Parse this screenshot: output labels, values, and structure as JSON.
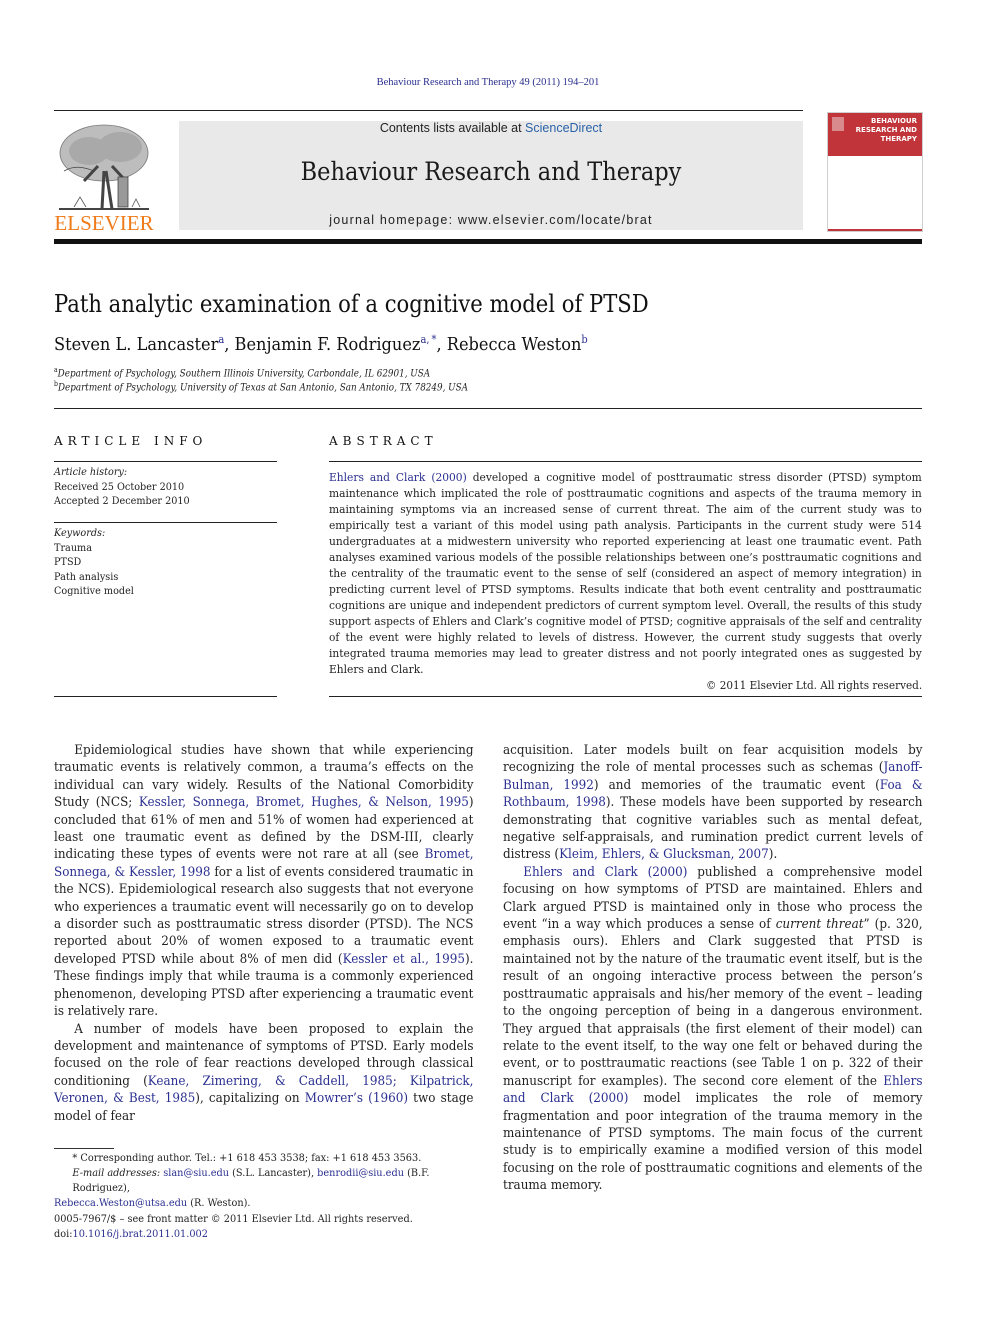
{
  "header": {
    "citation": "Behaviour Research and Therapy 49 (2011) 194–201",
    "publisher_logo_text": "ELSEVIER",
    "contents_prefix": "Contents lists available at ",
    "contents_link": "ScienceDirect",
    "journal_title": "Behaviour Research and Therapy",
    "homepage": "journal homepage: www.elsevier.com/locate/brat",
    "cover_title_lines": [
      "BEHAVIOUR",
      "RESEARCH AND",
      "THERAPY"
    ],
    "colors": {
      "brand_orange": "#f07b1a",
      "cover_red": "#c0343a",
      "link_blue": "#2a2f8f",
      "masthead_gray": "#e9e9e9"
    }
  },
  "article": {
    "title": "Path analytic examination of a cognitive model of PTSD",
    "authors": [
      {
        "name": "Steven L. Lancaster",
        "sup": "a"
      },
      {
        "name": "Benjamin F. Rodriguez",
        "sup": "a, *"
      },
      {
        "name": "Rebecca Weston",
        "sup": "b"
      }
    ],
    "affiliations": [
      {
        "sup": "a",
        "text": "Department of Psychology, Southern Illinois University, Carbondale, IL 62901, USA"
      },
      {
        "sup": "b",
        "text": "Department of Psychology, University of Texas at San Antonio, San Antonio, TX 78249, USA"
      }
    ]
  },
  "article_info": {
    "heading": "ARTICLE INFO",
    "history_label": "Article history:",
    "received": "Received 25 October 2010",
    "accepted": "Accepted 2 December 2010",
    "keywords_label": "Keywords:",
    "keywords": [
      "Trauma",
      "PTSD",
      "Path analysis",
      "Cognitive model"
    ]
  },
  "abstract": {
    "heading": "ABSTRACT",
    "link": "Ehlers and Clark (2000)",
    "text": " developed a cognitive model of posttraumatic stress disorder (PTSD) symptom maintenance which implicated the role of posttraumatic cognitions and aspects of the trauma memory in maintaining symptoms via an increased sense of current threat. The aim of the current study was to empirically test a variant of this model using path analysis. Participants in the current study were 514 undergraduates at a midwestern university who reported experiencing at least one traumatic event. Path analyses examined various models of the possible relationships between one’s posttraumatic cognitions and the centrality of the traumatic event to the sense of self (considered an aspect of memory integration) in predicting current level of PTSD symptoms. Results indicate that both event centrality and posttraumatic cognitions are unique and independent predictors of current symptom level. Overall, the results of this study support aspects of Ehlers and Clark’s cognitive model of PTSD; cognitive appraisals of the self and centrality of the event were highly related to levels of distress. However, the current study suggests that overly integrated trauma memories may lead to greater distress and not poorly integrated ones as suggested by Ehlers and Clark.",
    "copyright": "© 2011 Elsevier Ltd. All rights reserved."
  },
  "body": {
    "p1": [
      {
        "t": "Epidemiological studies have shown that while experiencing traumatic events is relatively common, a trauma’s effects on the individual can vary widely. Results of the National Comorbidity Study (NCS; "
      },
      {
        "l": "Kessler, Sonnega, Bromet, Hughes, & Nelson, 1995"
      },
      {
        "t": ") concluded that 61% of men and 51% of women had experienced at least one traumatic event as defined by the DSM-III, clearly indicating these types of events were not rare at all (see "
      },
      {
        "l": "Bromet, Sonnega, & Kessler, 1998"
      },
      {
        "t": " for a list of events considered traumatic in the NCS). Epidemiological research also suggests that not everyone who experiences a traumatic event will necessarily go on to develop a disorder such as posttraumatic stress disorder (PTSD). The NCS reported about 20% of women exposed to a traumatic event developed PTSD while about 8% of men did ("
      },
      {
        "l": "Kessler et al., 1995"
      },
      {
        "t": "). These findings imply that while trauma is a commonly experienced phenomenon, developing PTSD after experiencing a traumatic event is relatively rare."
      }
    ],
    "p2": [
      {
        "t": "A number of models have been proposed to explain the development and maintenance of symptoms of PTSD. Early models focused on the role of fear reactions developed through classical conditioning ("
      },
      {
        "l": "Keane, Zimering, & Caddell, 1985; Kilpatrick, Veronen, & Best, 1985"
      },
      {
        "t": "), capitalizing on "
      },
      {
        "l": "Mowrer’s (1960)"
      },
      {
        "t": " two stage model of fear"
      }
    ],
    "p3": [
      {
        "t": "acquisition. Later models built on fear acquisition models by recognizing the role of mental processes such as schemas ("
      },
      {
        "l": "Janoff-Bulman, 1992"
      },
      {
        "t": ") and memories of the traumatic event ("
      },
      {
        "l": "Foa & Rothbaum, 1998"
      },
      {
        "t": "). These models have been supported by research demonstrating that cognitive variables such as mental defeat, negative self-appraisals, and rumination predict current levels of distress ("
      },
      {
        "l": "Kleim, Ehlers, & Glucksman, 2007"
      },
      {
        "t": ")."
      }
    ],
    "p4": [
      {
        "l": "Ehlers and Clark (2000)"
      },
      {
        "t": " published a comprehensive model focusing on how symptoms of PTSD are maintained. Ehlers and Clark argued PTSD is maintained only in those who process the event “in a way which produces a sense of "
      },
      {
        "i": "current threat"
      },
      {
        "t": "” (p. 320, emphasis ours). Ehlers and Clark suggested that PTSD is maintained not by the nature of the traumatic event itself, but is the result of an ongoing interactive process between the person’s posttraumatic appraisals and his/her memory of the event – leading to the ongoing perception of being in a dangerous environment. They argued that appraisals (the first element of their model) can relate to the event itself, to the way one felt or behaved during the event, or to posttraumatic reactions (see Table 1 on p. 322 of their manuscript for examples). The second core element of the "
      },
      {
        "l": "Ehlers and Clark (2000)"
      },
      {
        "t": " model implicates the role of memory fragmentation and poor integration of the trauma memory in the maintenance of PTSD symptoms. The main focus of the current study is to empirically examine a modified version of this model focusing on the role of posttraumatic cognitions and elements of the trauma memory."
      }
    ]
  },
  "footnotes": {
    "corresponding": "* Corresponding author. Tel.: +1 618 453 3538; fax: +1 618 453 3563.",
    "email_label": "E-mail addresses: ",
    "emails": [
      {
        "addr": "slan@siu.edu",
        "who": " (S.L. Lancaster), "
      },
      {
        "addr": "benrodii@siu.edu",
        "who": " (B.F. Rodriguez), "
      },
      {
        "addr": "Rebecca.Weston@utsa.edu",
        "who": " (R. Weston)."
      }
    ],
    "front_matter": "0005-7967/$ – see front matter © 2011 Elsevier Ltd. All rights reserved.",
    "doi_label": "doi:",
    "doi": "10.1016/j.brat.2011.01.002"
  }
}
